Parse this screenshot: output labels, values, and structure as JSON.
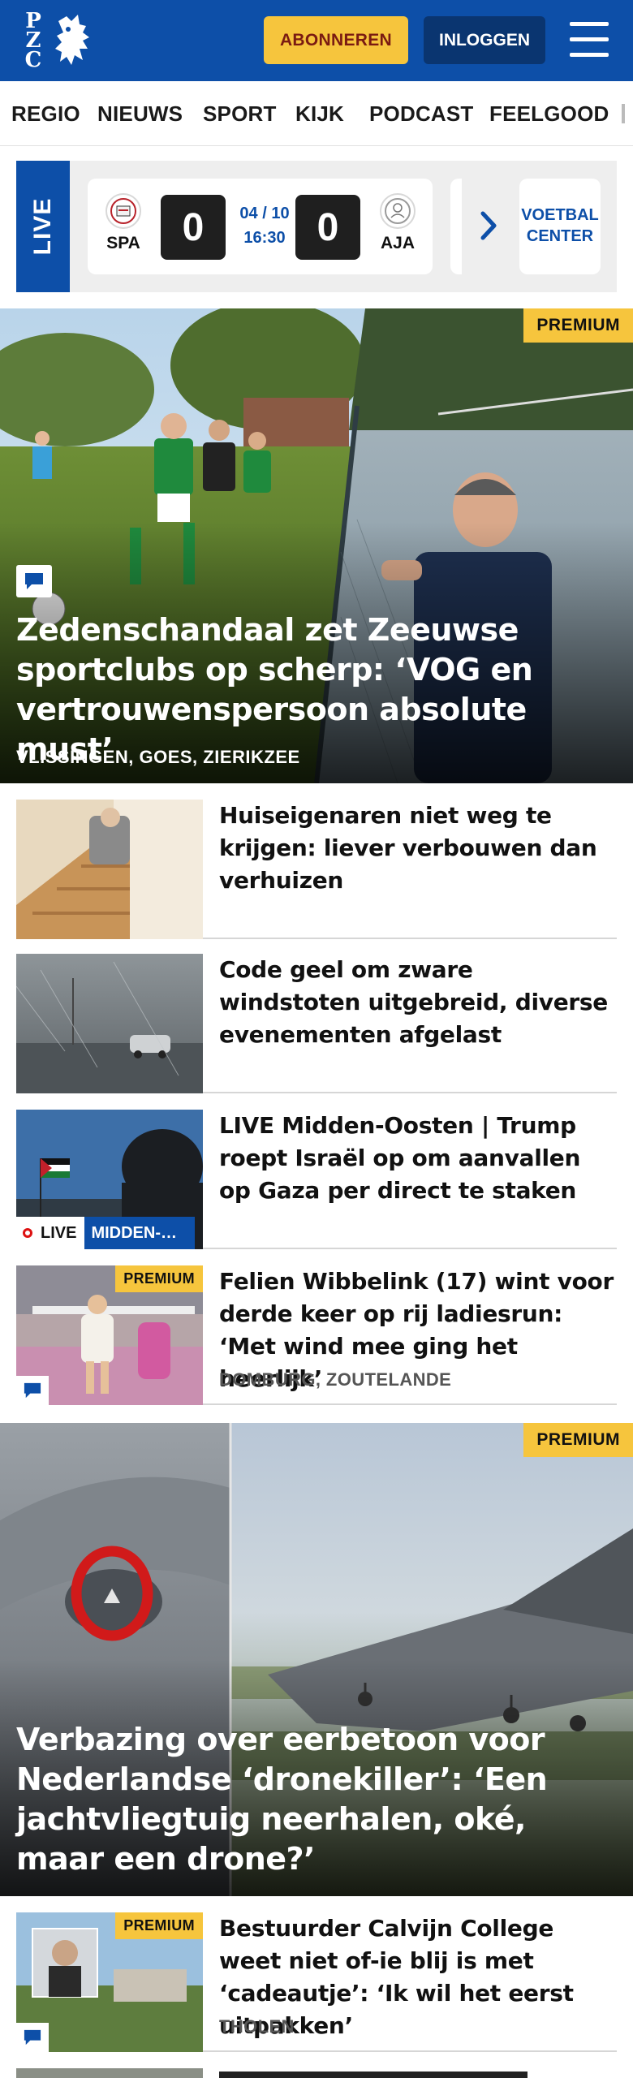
{
  "header": {
    "logo_text": "PZC",
    "subscribe_label": "ABONNEREN",
    "login_label": "INLOGGEN",
    "brand_color": "#0d4fa8",
    "accent_color": "#f6c53d"
  },
  "nav": {
    "items": [
      "REGIO",
      "NIEUWS",
      "SPORT",
      "KIJK",
      "PODCAST",
      "FEELGOOD"
    ]
  },
  "live": {
    "label": "LIVE",
    "match": {
      "home": "SPA",
      "away": "AJA",
      "home_score": "0",
      "away_score": "0",
      "date": "04 / 10",
      "time": "16:30"
    },
    "center_line1": "VOETBAL",
    "center_line2": "CENTER"
  },
  "hero1": {
    "badge": "PREMIUM",
    "title": "Zedenschandaal zet Zeeuwse sportclubs op scherp: ‘VOG en vertrouwenspersoon absolute must’",
    "location": "VLISSINGEN, GOES, ZIERIKZEE",
    "icon": "comment-icon"
  },
  "articles": [
    {
      "title": "Huiseigenaren niet weg te krijgen: liever verbouwen dan verhuizen"
    },
    {
      "title": "Code geel om zware windstoten uitgebreid, diverse evenementen afgelast"
    },
    {
      "title": "LIVE Midden-Oosten | Trump roept Israël op om aanvallen op Gaza per direct te staken",
      "live_label": "LIVE",
      "section_label": "MIDDEN-OOSTEN"
    },
    {
      "title": "Felien Wibbelink (17) wint voor derde keer op rij ladiesrun: ‘Met wind mee ging het heerlijk’",
      "badge": "PREMIUM",
      "location": "DOMBURG, ZOUTELANDE"
    }
  ],
  "hero2": {
    "badge": "PREMIUM",
    "title": "Verbazing over eerbetoon voor Nederlandse ‘dronekiller’: ‘Een jachtvliegtuig neerhalen, oké, maar een drone?’"
  },
  "articles2": [
    {
      "title": "Bestuurder Calvijn College weet niet of-ie blij is met ‘cadeautje’: ‘Ik wil het eerst uitpakken’",
      "badge": "PREMIUM",
      "location": "THOLEN"
    }
  ]
}
